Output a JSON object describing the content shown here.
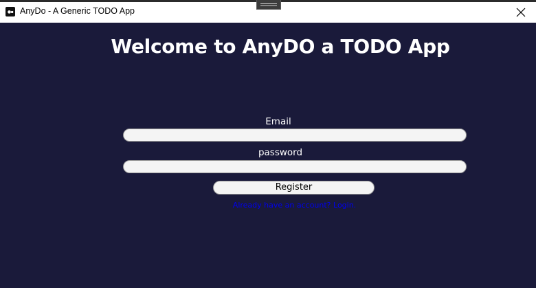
{
  "window": {
    "title": "AnyDo - A Generic TODO App",
    "icon": "app-logo-icon",
    "close_icon": "close-icon"
  },
  "main": {
    "heading": "Welcome to AnyDO a TODO App",
    "form": {
      "email_label": "Email",
      "email_value": "",
      "password_label": "password",
      "password_value": "",
      "register_label": "Register",
      "login_link": "Already have an account? Login."
    }
  },
  "colors": {
    "background": "#1a1a3a",
    "text": "#ffffff",
    "link": "#0000ee",
    "input_bg": "#f4f4f4"
  }
}
